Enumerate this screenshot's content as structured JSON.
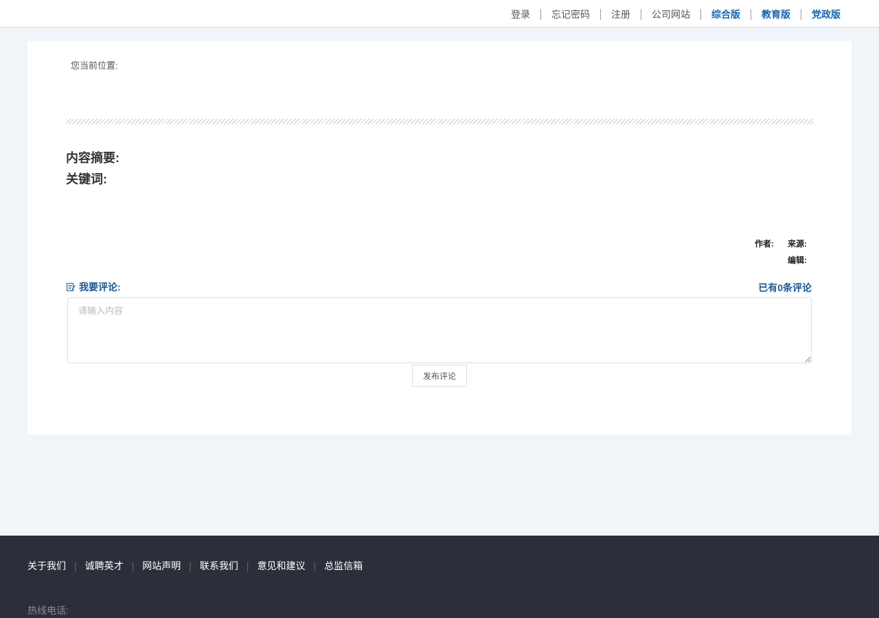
{
  "topnav": {
    "items": [
      {
        "label": "登录",
        "bold": false
      },
      {
        "label": "忘记密码",
        "bold": false
      },
      {
        "label": "注册",
        "bold": false
      },
      {
        "label": "公司网站",
        "bold": false
      },
      {
        "label": "综合版",
        "bold": true
      },
      {
        "label": "教育版",
        "bold": true
      },
      {
        "label": "党政版",
        "bold": true
      }
    ]
  },
  "article": {
    "breadcrumb": "您当前位置:",
    "summary_label": "内容摘要:",
    "keywords_label": "关键词:",
    "author_label": "作者:",
    "source_label": "来源:",
    "editor_label": "编辑:"
  },
  "comments": {
    "heading": "我要评论:",
    "count_text": "已有0条评论",
    "placeholder": "请输入内容",
    "submit_label": "发布评论",
    "accent_color": "#1a5896"
  },
  "footer": {
    "links": [
      "关于我们",
      "诚聘英才",
      "网站声明",
      "联系我们",
      "意见和建议",
      "总监信箱"
    ],
    "hotline": "热线电话:"
  },
  "colors": {
    "page_bg": "#f1f5f9",
    "nav_accent": "#1465b5",
    "footer_bg": "#2c2f3a"
  }
}
